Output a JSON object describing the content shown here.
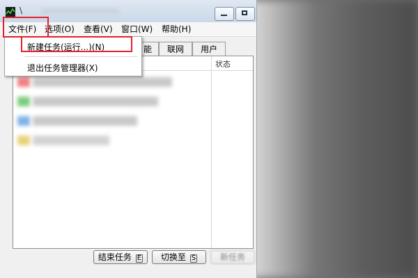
{
  "window": {
    "title": "\\"
  },
  "menubar": {
    "items": [
      {
        "label": "文件(F)"
      },
      {
        "label": "选项(O)"
      },
      {
        "label": "查看(V)"
      },
      {
        "label": "窗口(W)"
      },
      {
        "label": "帮助(H)"
      }
    ]
  },
  "file_menu": {
    "items": [
      {
        "label": "新建任务(运行...)(N)"
      },
      {
        "label": "退出任务管理器(X)"
      }
    ]
  },
  "tabs": [
    {
      "label": "能"
    },
    {
      "label": "联网"
    },
    {
      "label": "用户"
    }
  ],
  "list": {
    "status_header": "状态"
  },
  "buttons": {
    "end_task": {
      "label": "结束任务",
      "key": "E"
    },
    "switch_to": {
      "label": "切换至",
      "key": "S"
    },
    "new_task": {
      "label": "新任务"
    }
  },
  "colors": {
    "highlight": "#e51f2a",
    "titlebar": "#cbd8e8"
  },
  "icons": {
    "app": "task-manager-icon",
    "minimize": "minimize-icon",
    "maximize": "maximize-icon"
  }
}
